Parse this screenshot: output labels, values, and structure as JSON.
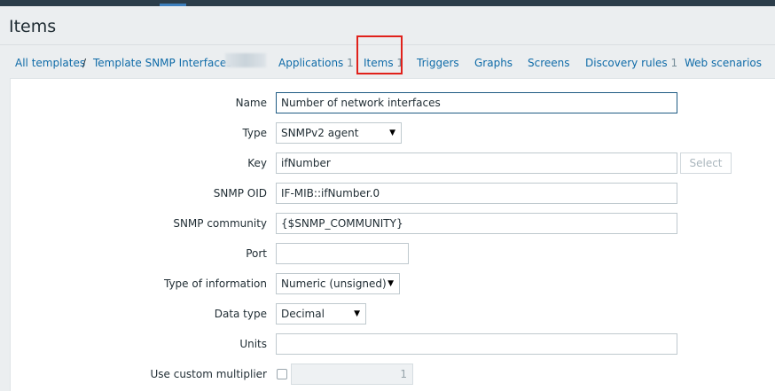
{
  "page": {
    "title": "Items"
  },
  "breadcrumb": {
    "all_templates": "All templates",
    "separator": "/",
    "template_name": "Template SNMP Interfaces"
  },
  "tabs": [
    {
      "label": "Applications",
      "count": "1"
    },
    {
      "label": "Items",
      "count": "1"
    },
    {
      "label": "Triggers",
      "count": ""
    },
    {
      "label": "Graphs",
      "count": ""
    },
    {
      "label": "Screens",
      "count": ""
    },
    {
      "label": "Discovery rules",
      "count": "1"
    },
    {
      "label": "Web scenarios",
      "count": ""
    }
  ],
  "form": {
    "name": {
      "label": "Name",
      "value": "Number of network interfaces"
    },
    "type": {
      "label": "Type",
      "value": "SNMPv2 agent"
    },
    "key": {
      "label": "Key",
      "value": "ifNumber",
      "select_button": "Select"
    },
    "snmp_oid": {
      "label": "SNMP OID",
      "value": "IF-MIB::ifNumber.0"
    },
    "snmp_community": {
      "label": "SNMP community",
      "value": "{$SNMP_COMMUNITY}"
    },
    "port": {
      "label": "Port",
      "value": ""
    },
    "type_of_information": {
      "label": "Type of information",
      "value": "Numeric (unsigned)"
    },
    "data_type": {
      "label": "Data type",
      "value": "Decimal"
    },
    "units": {
      "label": "Units",
      "value": ""
    },
    "custom_multiplier": {
      "label": "Use custom multiplier",
      "value": "1"
    }
  },
  "colors": {
    "link": "#0f6ba8",
    "highlight_box": "#e0211b",
    "header_bar": "#2b3d4a"
  }
}
